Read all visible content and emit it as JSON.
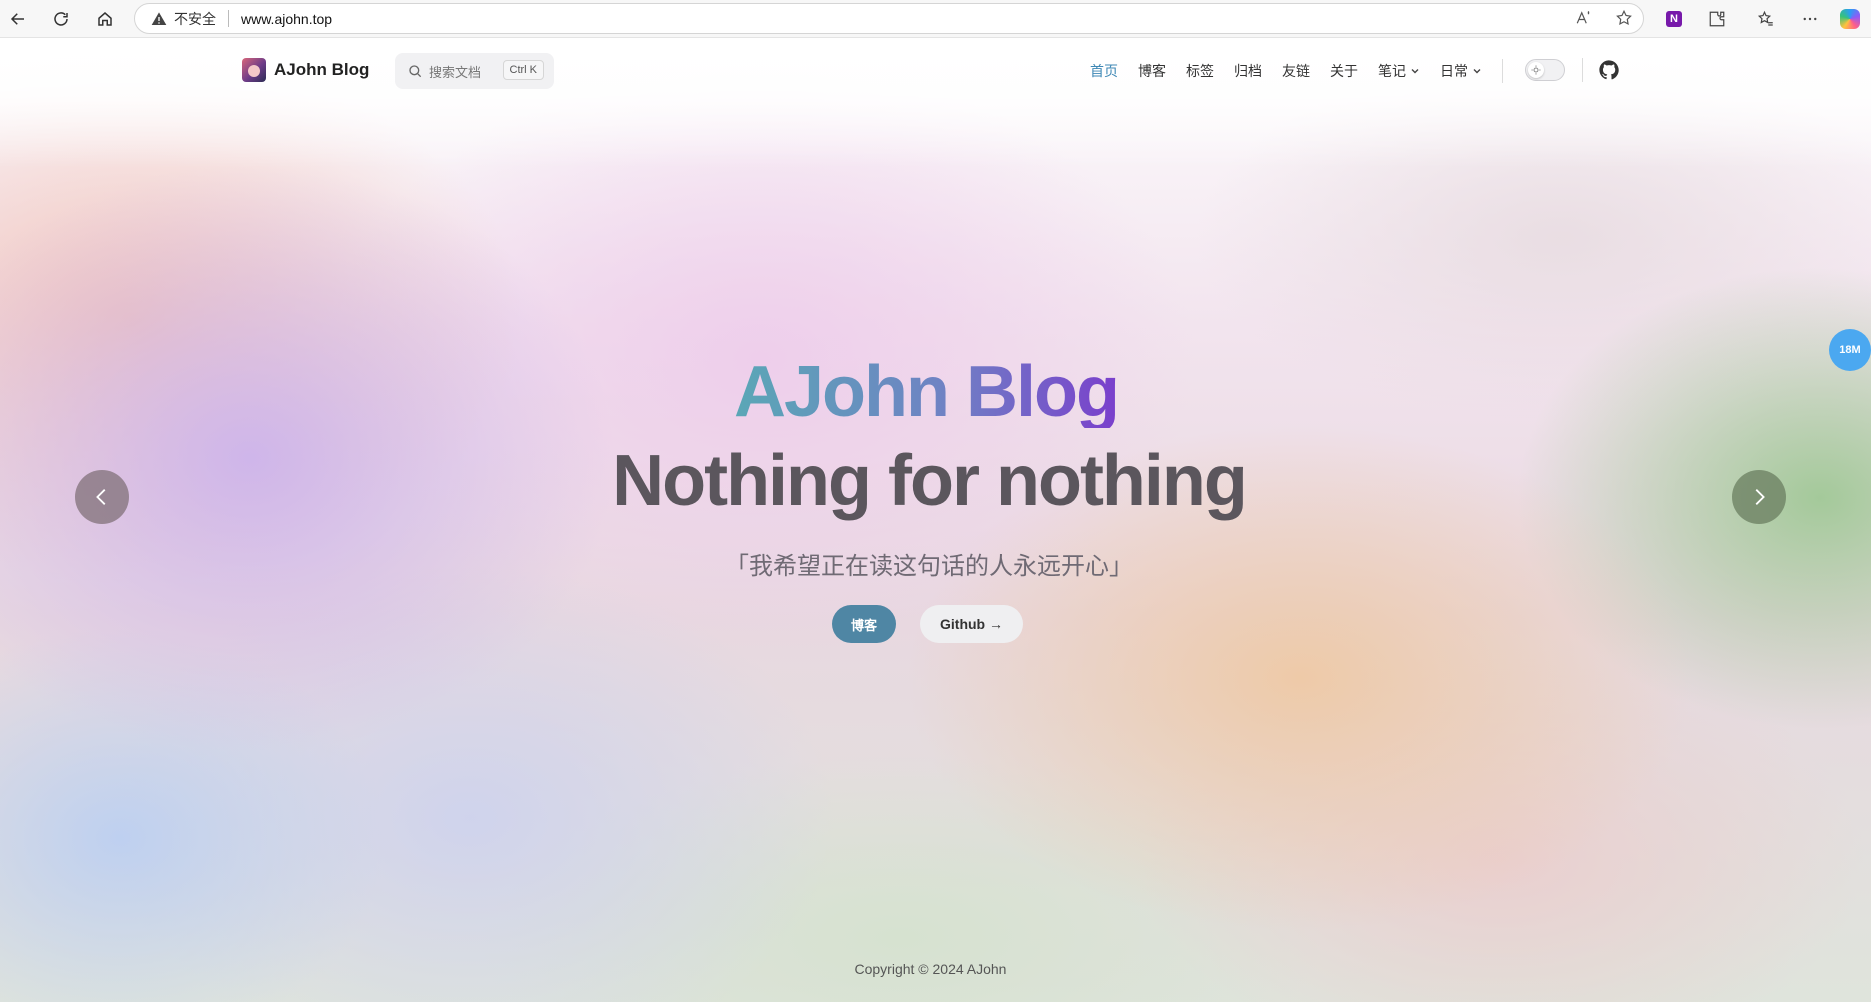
{
  "browser": {
    "insecure_label": "不安全",
    "url": "www.ajohn.top"
  },
  "header": {
    "brand_title": "AJohn Blog",
    "search_placeholder": "搜索文档",
    "search_shortcut": "Ctrl K",
    "nav": [
      {
        "label": "首页",
        "active": true
      },
      {
        "label": "博客"
      },
      {
        "label": "标签"
      },
      {
        "label": "归档"
      },
      {
        "label": "友链"
      },
      {
        "label": "关于"
      },
      {
        "label": "笔记",
        "dropdown": true
      },
      {
        "label": "日常",
        "dropdown": true
      }
    ]
  },
  "hero": {
    "title": "AJohn Blog",
    "tagline": "Nothing for nothing",
    "quote": "「我希望正在读这句话的人永远开心」",
    "primary_button": "博客",
    "secondary_button": "Github →"
  },
  "float_badge": "18M",
  "footer": {
    "copyright": "Copyright © 2024 AJohn"
  },
  "colors": {
    "accent": "#3f88b5",
    "primary_button": "#4f86a4",
    "badge": "#4ba8f0"
  }
}
